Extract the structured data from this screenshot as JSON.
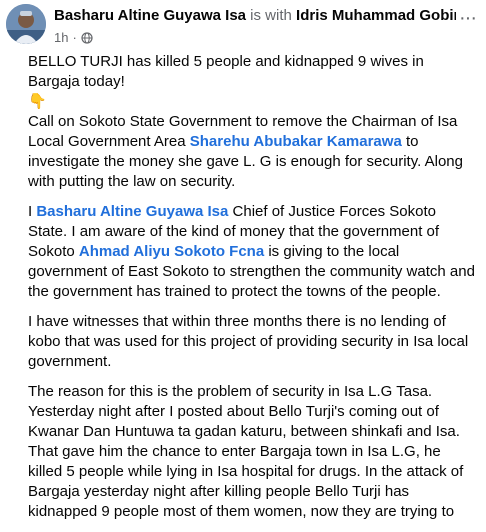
{
  "post": {
    "author": "Basharu Altine Guyawa Isa",
    "with_text": " is with ",
    "tagged": "Idris Muhammad Gobir.",
    "time": "1h",
    "dot": "·",
    "more_label": "···",
    "paragraphs": {
      "p1": {
        "line1": "BELLO TURJI has killed 5 people and kidnapped 9 wives in Bargaja today!",
        "emoji": "👇",
        "t1": "Call on Sokoto State Government to remove the Chairman of Isa Local Government Area ",
        "m1": "Sharehu Abubakar Kamarawa",
        "t2": " to investigate the money she gave L. G is enough for security. Along with putting the law on security."
      },
      "p2": {
        "t0": "I ",
        "m1": "Basharu Altine Guyawa Isa",
        "t1": " Chief of Justice Forces Sokoto State. I am aware of the kind of money that the government of Sokoto ",
        "m2": "Ahmad Aliyu Sokoto Fcna",
        "t2": " is giving to the local government of East Sokoto to strengthen the community watch and the government has trained to protect the towns of the people."
      },
      "p3": "I have witnesses that within three months there is no lending of kobo that was used for this project of providing security in Isa local government.",
      "p4": "The reason for this is the problem of security in Isa L.G Tasa. Yesterday night after I posted about Bello Turji's coming out of Kwanar Dan Huntuwa ta gadan katuru, between shinkafi and Isa. That gave him the chance to enter Bargaja town in Isa L.G, he killed 5 people while lying in Isa hospital for drugs. In the attack of Bargaja yesterday night after killing people Bello Turji has kidnapped 9 people most of them women, now they are trying to"
    }
  },
  "colors": {
    "mention": "#216fdb",
    "secondary_text": "#65676b"
  },
  "icons": {
    "privacy": "globe-icon",
    "avatar": "profile-photo"
  }
}
